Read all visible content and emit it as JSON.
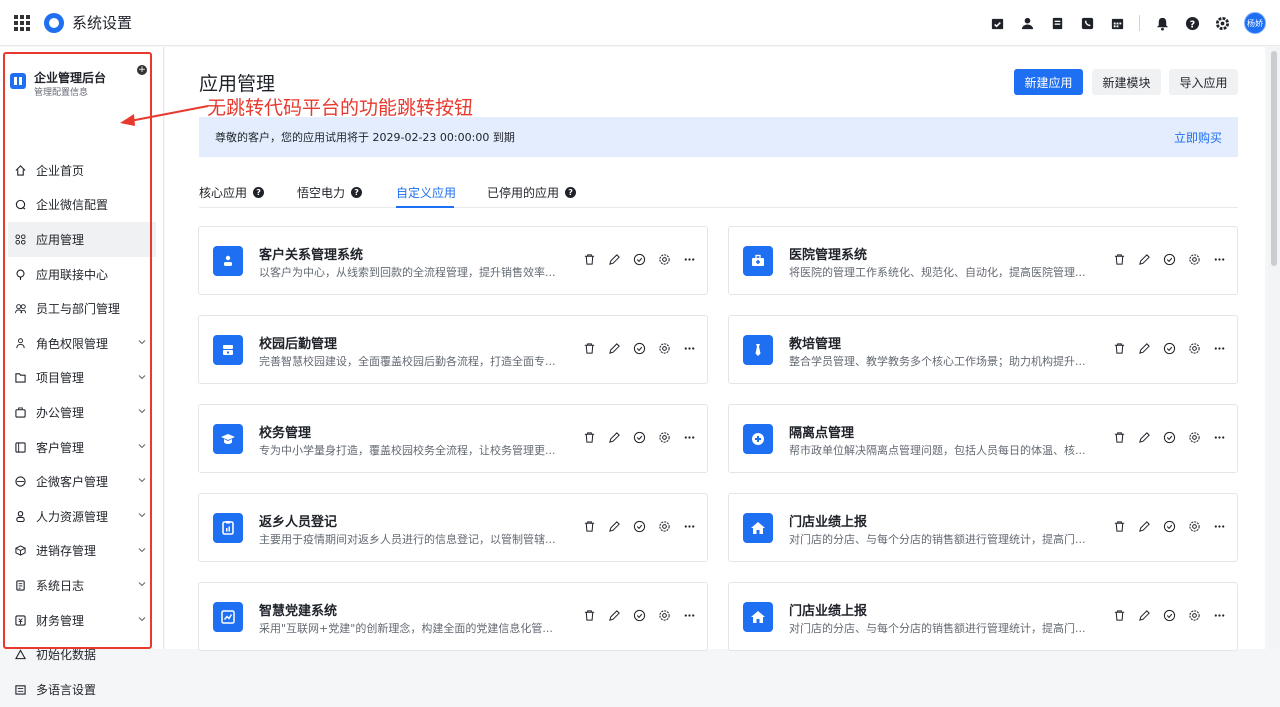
{
  "topbar": {
    "title": "系统设置",
    "icons": [
      "calendar-check-icon",
      "user-icon",
      "document-icon",
      "phone-icon",
      "calendar-icon",
      "bell-icon",
      "help-icon",
      "gear-icon"
    ],
    "avatar": "杨娇"
  },
  "sidebar": {
    "title": "企业管理后台",
    "subtitle": "管理配置信息",
    "items": [
      {
        "label": "企业首页",
        "icon": "home-icon",
        "expandable": false,
        "active": false
      },
      {
        "label": "企业微信配置",
        "icon": "chat-icon",
        "expandable": false,
        "active": false
      },
      {
        "label": "应用管理",
        "icon": "apps-icon",
        "expandable": false,
        "active": true
      },
      {
        "label": "应用联接中心",
        "icon": "bulb-icon",
        "expandable": false,
        "active": false
      },
      {
        "label": "员工与部门管理",
        "icon": "users-icon",
        "expandable": false,
        "active": false
      },
      {
        "label": "角色权限管理",
        "icon": "role-icon",
        "expandable": true,
        "active": false
      },
      {
        "label": "项目管理",
        "icon": "folder-icon",
        "expandable": true,
        "active": false
      },
      {
        "label": "办公管理",
        "icon": "office-icon",
        "expandable": true,
        "active": false
      },
      {
        "label": "客户管理",
        "icon": "customer-icon",
        "expandable": true,
        "active": false
      },
      {
        "label": "企微客户管理",
        "icon": "wecom-icon",
        "expandable": true,
        "active": false
      },
      {
        "label": "人力资源管理",
        "icon": "person-icon",
        "expandable": true,
        "active": false
      },
      {
        "label": "进销存管理",
        "icon": "box-icon",
        "expandable": true,
        "active": false
      },
      {
        "label": "系统日志",
        "icon": "log-icon",
        "expandable": true,
        "active": false
      },
      {
        "label": "财务管理",
        "icon": "finance-icon",
        "expandable": true,
        "active": false
      },
      {
        "label": "初始化数据",
        "icon": "triangle-icon",
        "expandable": false,
        "active": false
      },
      {
        "label": "多语言设置",
        "icon": "language-icon",
        "expandable": false,
        "active": false
      }
    ]
  },
  "annotation": "无跳转代码平台的功能跳转按钮",
  "main": {
    "title": "应用管理",
    "buttons": {
      "new_app": "新建应用",
      "new_module": "新建模块",
      "import_app": "导入应用"
    },
    "notice": {
      "text": "尊敬的客户，您的应用试用将于 2029-02-23 00:00:00 到期",
      "buy": "立即购买"
    },
    "tabs": [
      {
        "label": "核心应用",
        "help": true
      },
      {
        "label": "悟空电力",
        "help": true
      },
      {
        "label": "自定义应用",
        "help": false
      },
      {
        "label": "已停用的应用",
        "help": true
      }
    ],
    "cards": [
      {
        "title": "客户关系管理系统",
        "desc": "以客户为中心，从线索到回款的全流程管理，提升销售效率...",
        "icon": "crm-icon"
      },
      {
        "title": "医院管理系统",
        "desc": "将医院的管理工作系统化、规范化、自动化，提高医院管理...",
        "icon": "hospital-icon"
      },
      {
        "title": "校园后勤管理",
        "desc": "完善智慧校园建设，全面覆盖校园后勤各流程，打造全面专...",
        "icon": "logistics-icon"
      },
      {
        "title": "教培管理",
        "desc": "整合学员管理、教学教务多个核心工作场景；助力机构提升...",
        "icon": "tie-icon"
      },
      {
        "title": "校务管理",
        "desc": "专为中小学量身打造，覆盖校园校务全流程，让校务管理更...",
        "icon": "graduation-icon"
      },
      {
        "title": "隔离点管理",
        "desc": "帮市政单位解决隔离点管理问题，包括人员每日的体温、核...",
        "icon": "isolation-icon"
      },
      {
        "title": "返乡人员登记",
        "desc": "主要用于疫情期间对返乡人员进行的信息登记，以管制管辖...",
        "icon": "register-icon"
      },
      {
        "title": "门店业绩上报",
        "desc": "对门店的分店、与每个分店的销售额进行管理统计，提高门...",
        "icon": "store-icon"
      },
      {
        "title": "智慧党建系统",
        "desc": "采用\"互联网+党建\"的创新理念，构建全面的党建信息化管...",
        "icon": "chart-icon"
      },
      {
        "title": "门店业绩上报",
        "desc": "对门店的分店、与每个分店的销售额进行管理统计，提高门...",
        "icon": "store-icon"
      }
    ],
    "card_actions": [
      "trash-icon",
      "edit-icon",
      "shield-icon",
      "settings-icon",
      "more-icon"
    ]
  }
}
